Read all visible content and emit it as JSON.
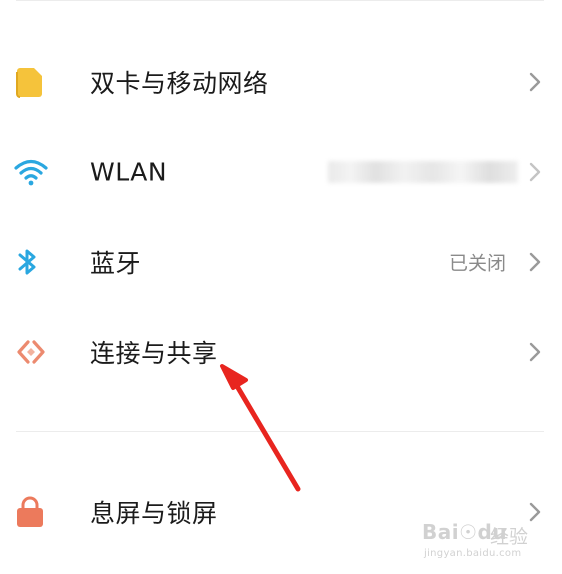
{
  "settings": {
    "items": [
      {
        "label": "双卡与移动网络",
        "value": "",
        "icon": "sim-card-icon"
      },
      {
        "label": "WLAN",
        "value": "",
        "icon": "wifi-icon"
      },
      {
        "label": "蓝牙",
        "value": "已关闭",
        "icon": "bluetooth-icon"
      },
      {
        "label": "连接与共享",
        "value": "",
        "icon": "connection-share-icon"
      },
      {
        "label": "息屏与锁屏",
        "value": "",
        "icon": "lock-icon"
      }
    ]
  },
  "watermark": {
    "brand": "Bai☉du",
    "section": "经验",
    "url": "jingyan.baidu.com"
  },
  "colors": {
    "sim_icon": "#f5c33b",
    "wifi_icon": "#2aa7e0",
    "bluetooth_icon": "#2aa7e0",
    "share_icon": "#ec8a6f",
    "lock_icon": "#ec7a5c",
    "annotation_arrow": "#e8251f"
  }
}
